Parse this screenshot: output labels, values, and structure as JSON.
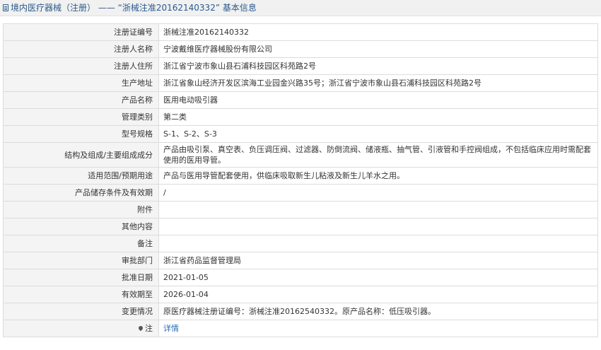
{
  "header": {
    "title": "境内医疗器械（注册） —— “浙械注准20162140332” 基本信息",
    "icon": "document-icon"
  },
  "fields": [
    {
      "label": "注册证编号",
      "value": "浙械注准20162140332"
    },
    {
      "label": "注册人名称",
      "value": "宁波戴维医疗器械股份有限公司"
    },
    {
      "label": "注册人住所",
      "value": "浙江省宁波市象山县石浦科技园区科苑路2号"
    },
    {
      "label": "生产地址",
      "value": "浙江省象山经济开发区滨海工业园金兴路35号；浙江省宁波市象山县石浦科技园区科苑路2号"
    },
    {
      "label": "产品名称",
      "value": "医用电动吸引器"
    },
    {
      "label": "管理类别",
      "value": "第二类"
    },
    {
      "label": "型号规格",
      "value": "S-1、S-2、S-3"
    },
    {
      "label": "结构及组成/主要组成成分",
      "value": "产品由吸引泵、真空表、负压调压阀、过滤器、防倒流阀、储液瓶、抽气管、引液管和手控阀组成，不包括临床应用时需配套使用的医用导管。"
    },
    {
      "label": "适用范围/预期用途",
      "value": "产品与医用导管配套使用，供临床吸取新生儿粘液及新生儿羊水之用。"
    },
    {
      "label": "产品储存条件及有效期",
      "value": "/"
    },
    {
      "label": "附件",
      "value": ""
    },
    {
      "label": "其他内容",
      "value": ""
    },
    {
      "label": "备注",
      "value": ""
    },
    {
      "label": "审批部门",
      "value": "浙江省药品监督管理局"
    },
    {
      "label": "批准日期",
      "value": "2021-01-05"
    },
    {
      "label": "有效期至",
      "value": "2026-01-04"
    },
    {
      "label": "变更情况",
      "value": "原医疗器械注册证编号：浙械注准20162540332。原产品名称：低压吸引器。"
    }
  ],
  "note_row": {
    "label": "注",
    "icon": "pin-icon",
    "link_text": "详情"
  }
}
